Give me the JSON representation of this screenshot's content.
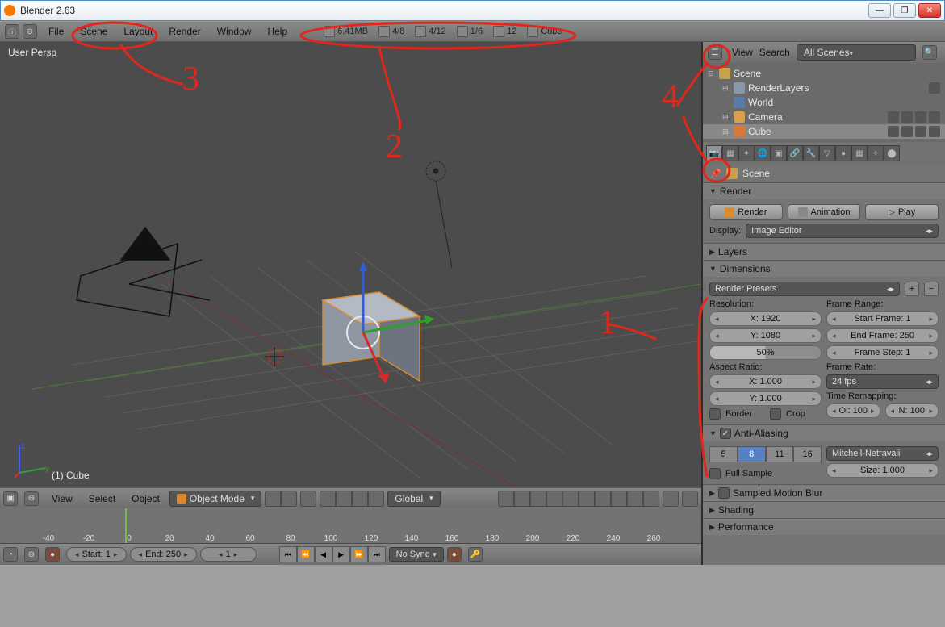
{
  "window": {
    "title": "Blender 2.63"
  },
  "topbar": {
    "menus": [
      "File",
      "Scene",
      "Layout",
      "Render",
      "Window",
      "Help"
    ],
    "stats": {
      "mem": "6.41MB",
      "verts": "4/8",
      "edges": "4/12",
      "faces": "1/6",
      "tris": "12",
      "obj": "Cube"
    }
  },
  "viewport": {
    "persp_label": "User Persp",
    "active_object": "(1) Cube"
  },
  "view3d_header": {
    "menus": [
      "View",
      "Select",
      "Object"
    ],
    "mode": "Object Mode",
    "orientation": "Global"
  },
  "timeline": {
    "ticks": [
      "-40",
      "-20",
      "0",
      "20",
      "40",
      "60",
      "80",
      "100",
      "120",
      "140",
      "160",
      "180",
      "200",
      "220",
      "240",
      "260"
    ],
    "start_label": "Start: 1",
    "end_label": "End: 250",
    "current": "1",
    "sync": "No Sync"
  },
  "outliner": {
    "menus": [
      "View",
      "Search"
    ],
    "filter": "All Scenes",
    "tree": {
      "scene": "Scene",
      "renderlayers": "RenderLayers",
      "world": "World",
      "camera": "Camera",
      "cube": "Cube"
    }
  },
  "properties": {
    "breadcrumb": "Scene",
    "render_panel": {
      "title": "Render",
      "render_btn": "Render",
      "animation_btn": "Animation",
      "play_btn": "Play",
      "display_label": "Display:",
      "display_value": "Image Editor"
    },
    "layers_panel": {
      "title": "Layers"
    },
    "dimensions": {
      "title": "Dimensions",
      "presets": "Render Presets",
      "resolution_label": "Resolution:",
      "res_x": "X: 1920",
      "res_y": "Y: 1080",
      "res_pct": "50%",
      "aspect_label": "Aspect Ratio:",
      "asp_x": "X: 1.000",
      "asp_y": "Y: 1.000",
      "border": "Border",
      "crop": "Crop",
      "frame_range_label": "Frame Range:",
      "frame_start": "Start Frame: 1",
      "frame_end": "End Frame: 250",
      "frame_step": "Frame Step: 1",
      "frame_rate_label": "Frame Rate:",
      "fps": "24 fps",
      "remap_label": "Time Remapping:",
      "remap_old": "Ol: 100",
      "remap_new": "N: 100"
    },
    "aa": {
      "title": "Anti-Aliasing",
      "levels": [
        "5",
        "8",
        "11",
        "16"
      ],
      "filter": "Mitchell-Netravali",
      "full_sample": "Full Sample",
      "size": "Size: 1.000"
    },
    "motion_blur": {
      "title": "Sampled Motion Blur"
    },
    "shading": {
      "title": "Shading"
    },
    "performance": {
      "title": "Performance"
    }
  },
  "annotations": {
    "n1": "1",
    "n2": "2",
    "n3": "3",
    "n4": "4"
  }
}
